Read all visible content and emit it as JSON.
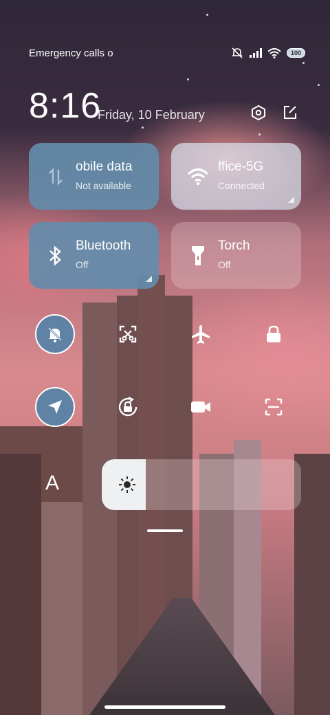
{
  "status_bar": {
    "carrier_text": "Emergency calls o",
    "battery": "100",
    "icons": [
      "mute-icon",
      "signal-icon",
      "wifi-icon",
      "battery-icon"
    ]
  },
  "header": {
    "time": "8:16",
    "date": "Friday, 10 February",
    "buttons": [
      "settings-icon",
      "edit-icon"
    ]
  },
  "tiles": {
    "mobile_data": {
      "title": "obile data",
      "subtitle": "Not available"
    },
    "wifi": {
      "title": "ffice-5G",
      "subtitle": "Connected"
    },
    "bluetooth": {
      "title": "Bluetooth",
      "subtitle": "Off"
    },
    "torch": {
      "title": "Torch",
      "subtitle": "Off"
    }
  },
  "toggles": [
    "silent-mode-icon",
    "screenshot-icon",
    "airplane-mode-icon",
    "lock-screen-icon",
    "location-icon",
    "rotation-lock-icon",
    "screen-record-icon",
    "scanner-icon"
  ],
  "brightness": {
    "level": 0.22,
    "font_label": "A"
  },
  "colors": {
    "tile_blue": "#648caa",
    "tile_pale": "#d7e1eb"
  }
}
